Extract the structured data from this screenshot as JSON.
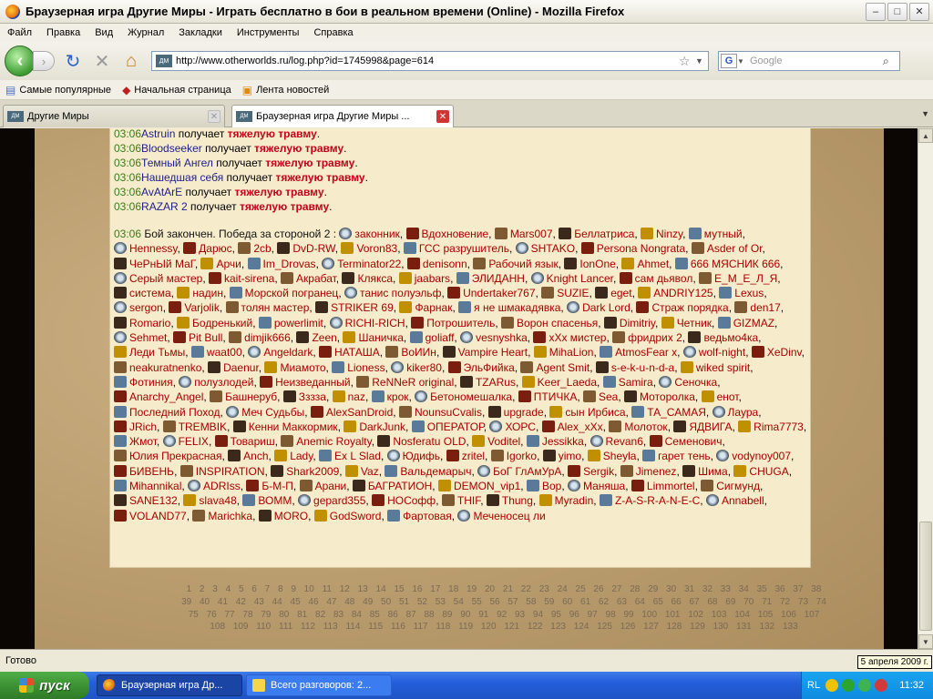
{
  "window": {
    "title": "Браузерная игра Другие Миры - Играть бесплатно в бои в реальном времени (Online) - Mozilla Firefox",
    "minimize": "–",
    "maximize": "□",
    "close": "✕"
  },
  "menu": [
    "Файл",
    "Правка",
    "Вид",
    "Журнал",
    "Закладки",
    "Инструменты",
    "Справка"
  ],
  "nav": {
    "url": "http://www.otherworlds.ru/log.php?id=1745998&page=614",
    "site_icon": "ДМ",
    "search_placeholder": "Google",
    "search_engine": "G"
  },
  "bookmarks": [
    "Самые популярные",
    "Начальная страница",
    "Лента новостей"
  ],
  "tabs": [
    {
      "label": "Другие Миры",
      "active": false
    },
    {
      "label": "Браузерная игра Другие Миры ...",
      "active": true
    }
  ],
  "log": {
    "lines": [
      {
        "time": "03:06",
        "player": "Astruin",
        "action": " получает ",
        "injury": "тяжелую травму",
        "end": "."
      },
      {
        "time": "03:06",
        "player": "Bloodseeker",
        "action": " получает ",
        "injury": "тяжелую травму",
        "end": "."
      },
      {
        "time": "03:06",
        "player": "Темный Ангел",
        "action": " получает ",
        "injury": "тяжелую травму",
        "end": "."
      },
      {
        "time": "03:06",
        "player": "Нашедшая себя",
        "action": " получает ",
        "injury": "тяжелую травму",
        "end": "."
      },
      {
        "time": "03:06",
        "player": "AvAtArE",
        "action": " получает ",
        "injury": "тяжелую травму",
        "end": "."
      },
      {
        "time": "03:06",
        "player": "RAZAR 2",
        "action": " получает ",
        "injury": "тяжелую травму",
        "end": "."
      }
    ],
    "battle_time": "03:06",
    "battle_text": " Бой закончен. Победа за стороной 2 : ",
    "winners": [
      "законник",
      "Вдохновение",
      "Mars007",
      "Беллатриса",
      "Ninzy",
      "мутный",
      "Hennessy",
      "Дарюс",
      "2cb",
      "DvD-RW",
      "Voron83",
      "ГСС разрушитель",
      "SHTAKO",
      "Persona Nongrata",
      "Asder of Or",
      "ЧеРнЫй МаГ",
      "Арчи",
      "Im_Drovas",
      "Terminator22",
      "denisonn",
      "Рабочий язык",
      "IonOne",
      "Ahmet",
      "666 МЯСНИК 666",
      "Серый мастер",
      "kait-sirena",
      "Акрабат",
      "Клякса",
      "jaabars",
      "ЭЛИДАНН",
      "Knight Lancer",
      "сам дьявол",
      "Е_М_Е_Л_Я",
      "система",
      "надин",
      "Морской погранец",
      "танис полуэльф",
      "Undertaker767",
      "SUZIE",
      "eget",
      "ANDRIY125",
      "Lexus",
      "sergon",
      "Varjolik",
      "толян мастер",
      "STRIKER 69",
      "Фарнак",
      "я не шмакадявка",
      "Dark Lord",
      "Страж порядка",
      "den17",
      "Romario",
      "Бодренький",
      "powerlimit",
      "RICHI-RICH",
      "Потрошитель",
      "Ворон спасенья",
      "Dimitriy",
      "Четник",
      "GIZMAZ",
      "Sehmet",
      "Pit Bull",
      "dimjik666",
      "Zeen",
      "Шаничка",
      "goliaff",
      "vesnyshka",
      "xXx мистер",
      "фридрих 2",
      "ведьмо4ка",
      "Леди Тьмы",
      "waat00",
      "Angeldark",
      "НАТАША",
      "ВоИИн",
      "Vampire Heart",
      "MihaLion",
      "AtmosFear x",
      "wolf-night",
      "XeDinv",
      "neakuratnenko",
      "Daenur",
      "Миамото",
      "Lioness",
      "kiker80",
      "ЭльФийка",
      "Agent Smit",
      "s-e-k-u-n-d-a",
      "wiked spirit",
      "Фотиния",
      "полузлодей",
      "Неизведанный",
      "ReNNeR original",
      "TZARus",
      "Keer_Laeda",
      "Samira",
      "Сеночка",
      "Anarchy_Angel",
      "Башнеруб",
      "Зззза",
      "naz",
      "крок",
      "Бетономешалка",
      "ПТИЧКА",
      "Sea",
      "Моторолка",
      "енот",
      "Последний Поход",
      "Меч Судьбы",
      "AlexSanDroid",
      "NounsuCvalis",
      "upgrade",
      "сын Ирбиса",
      "ТА_САМАЯ",
      "Лаура",
      "JRich",
      "TREMBIK",
      "Кенни Маккормик",
      "DarkJunk",
      "ОПЕРАТОР",
      "ХОРС",
      "Alex_xXx",
      "Молоток",
      "ЯДВИГА",
      "Rima7773",
      "Жмот",
      "FELIX",
      "Товариш",
      "Anemic Royalty",
      "Nosferatu OLD",
      "Voditel",
      "Jessikka",
      "Revan6",
      "Семенович",
      "Юлия Прекрасная",
      "Anch",
      "Lady",
      "Ex L Slad",
      "Юдифь",
      "zritel",
      "Igorko",
      "yimo",
      "Sheyla",
      "гарет тень",
      "vodynoy007",
      "БИВЕНЬ",
      "INSPIRATION",
      "Shark2009",
      "Vaz",
      "Вальдемарыч",
      "БоГ ГлАмУрА",
      "Sergik",
      "Jimenez",
      "Шима",
      "CHUGA",
      "Mihannikal",
      "ADRIss",
      "Б-М-П",
      "Арани",
      "БАГРАТИОН",
      "DEMON_vip1",
      "Вор",
      "Маняша",
      "Limmortel",
      "Сигмунд",
      "SANE132",
      "slava48",
      "ВОММ",
      "gepard355",
      "НОСофф",
      "THIF",
      "Thung",
      "Myradin",
      "Z-A-S-R-A-N-E-C",
      "Annabell",
      "VOLAND77",
      "Marichka",
      "MORO",
      "GodSword",
      "Фартовая",
      "Меченосец ли"
    ]
  },
  "pagination": {
    "pages": [
      "1",
      "2",
      "3",
      "4",
      "5",
      "6",
      "7",
      "8",
      "9",
      "10",
      "11",
      "12",
      "13",
      "14",
      "15",
      "16",
      "17",
      "18",
      "19",
      "20",
      "21",
      "22",
      "23",
      "24",
      "25",
      "26",
      "27",
      "28",
      "29",
      "30",
      "31",
      "32",
      "33",
      "34",
      "35",
      "36",
      "37",
      "38",
      "39",
      "40",
      "41",
      "42",
      "43",
      "44",
      "45",
      "46",
      "47",
      "48",
      "49",
      "50",
      "51",
      "52",
      "53",
      "54",
      "55",
      "56",
      "57",
      "58",
      "59",
      "60",
      "61",
      "62",
      "63",
      "64",
      "65",
      "66",
      "67",
      "68",
      "69",
      "70",
      "71",
      "72",
      "73",
      "74",
      "75",
      "76",
      "77",
      "78",
      "79",
      "80",
      "81",
      "82",
      "83",
      "84",
      "85",
      "86",
      "87",
      "88",
      "89",
      "90",
      "91",
      "92",
      "93",
      "94",
      "95",
      "96",
      "97",
      "98",
      "99",
      "100",
      "101",
      "102",
      "103",
      "104",
      "105",
      "106",
      "107",
      "108",
      "109",
      "110",
      "111",
      "112",
      "113",
      "114",
      "115",
      "116",
      "117",
      "118",
      "119",
      "120",
      "121",
      "122",
      "123",
      "124",
      "125",
      "126",
      "127",
      "128",
      "129",
      "130",
      "131",
      "132",
      "133"
    ]
  },
  "status": {
    "text": "Готово",
    "tooltip": "5 апреля 2009 г."
  },
  "taskbar": {
    "start": "пуск",
    "tasks": [
      "Браузерная игра Др...",
      "Всего разговоров: 2..."
    ],
    "lang": "RL",
    "clock": "11:32"
  }
}
